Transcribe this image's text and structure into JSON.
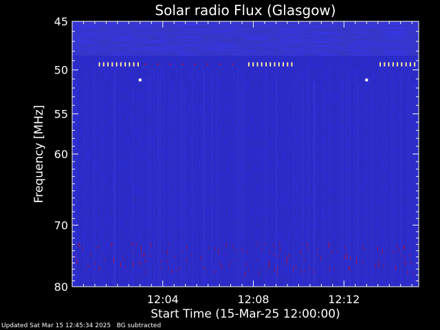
{
  "chart_data": {
    "type": "heatmap",
    "title": "Solar radio Flux (Glasgow)",
    "xlabel": "Start Time (15-Mar-25 12:00:00)",
    "ylabel": "Frequency [MHz]",
    "x_unit": "minutes after 12:00:00",
    "xlim": [
      0,
      15.3
    ],
    "ylim_log": [
      45,
      80
    ],
    "x_ticks": [
      {
        "label": "12:04",
        "value": 4
      },
      {
        "label": "12:08",
        "value": 8
      },
      {
        "label": "12:12",
        "value": 12
      }
    ],
    "y_ticks": [
      {
        "label": "45",
        "value": 45
      },
      {
        "label": "50",
        "value": 50
      },
      {
        "label": "55",
        "value": 55
      },
      {
        "label": "60",
        "value": 60
      },
      {
        "label": "70",
        "value": 70
      },
      {
        "label": "80",
        "value": 80
      }
    ],
    "y_scale": "log",
    "colors": {
      "background": "#1414b4",
      "panel_bg": "#000000",
      "axis": "#ffffff",
      "interference_dash": "#ffe9a0",
      "burst_dot": "#ffffff",
      "red_speck": "#c01030"
    },
    "interference_band_mhz": 49.4
  },
  "footer": {
    "updated": "Updated Sat Mar 15 12:45:34 2025",
    "note": "BG subtracted"
  }
}
